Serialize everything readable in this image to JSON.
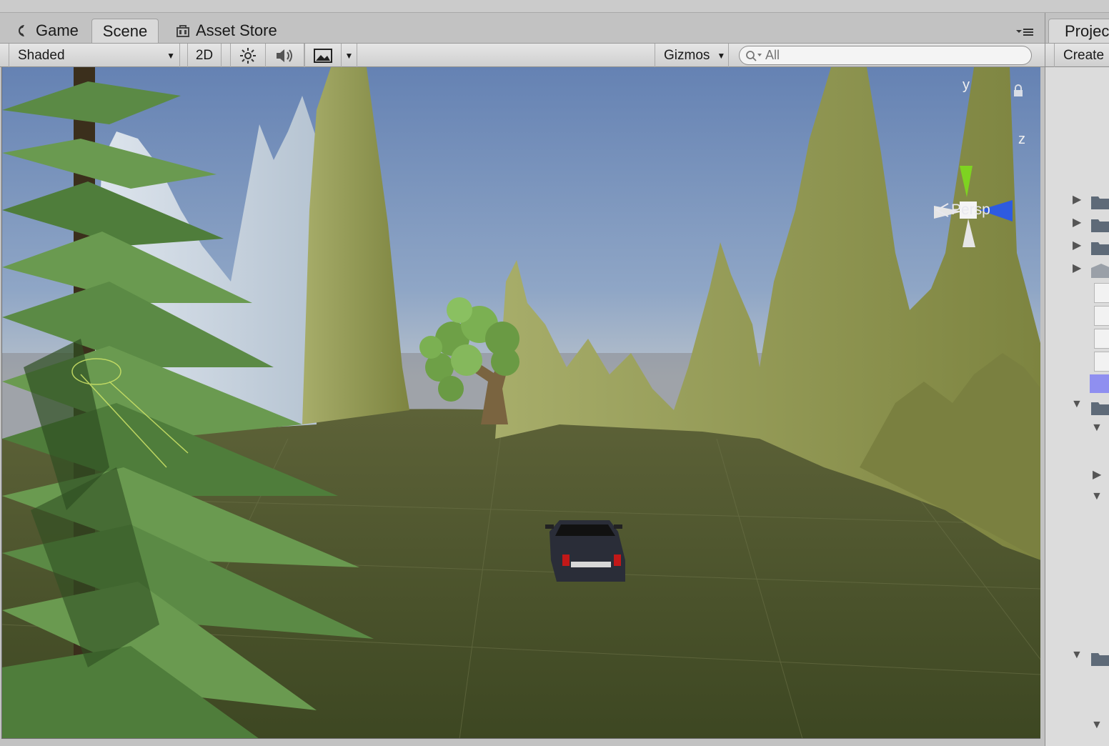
{
  "tabs": {
    "game": "Game",
    "scene": "Scene",
    "asset_store": "Asset Store"
  },
  "toolbar": {
    "draw_mode": "Shaded",
    "mode_2d": "2D",
    "gizmos": "Gizmos",
    "search_placeholder": "All"
  },
  "viewport": {
    "axis_y": "y",
    "axis_z": "z",
    "projection": "Persp"
  },
  "project_panel": {
    "tab_label": "Project",
    "create_label": "Create"
  },
  "icons": [
    "unity-logo-icon",
    "shop-icon",
    "tab-menu-icon",
    "sun-icon",
    "speaker-icon",
    "image-icon",
    "search-icon",
    "lock-icon",
    "folder-icon"
  ],
  "colors": {
    "sky_top": "#6b86b4",
    "sky_horizon": "#aab6c4",
    "ground": "#4a5230",
    "mountain": "#8e9450",
    "pine": "#5b8a45",
    "selection": "#8f8ff0",
    "gizmo_y": "#7ed321",
    "gizmo_z": "#2e5be0"
  }
}
